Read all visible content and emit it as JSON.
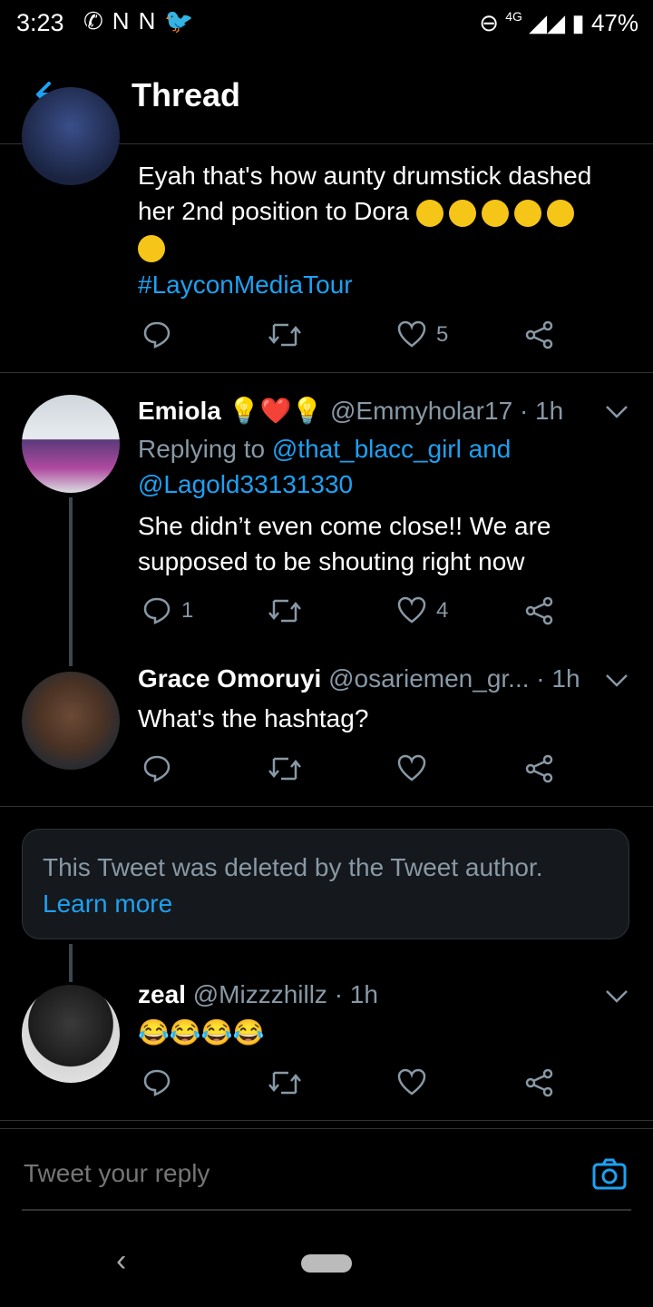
{
  "status_bar": {
    "time": "3:23",
    "notification_icons": [
      "whatsapp-icon",
      "n-icon",
      "n-icon",
      "twitter-icon"
    ],
    "network": "4G",
    "battery": "47%"
  },
  "header": {
    "title": "Thread"
  },
  "tweets": [
    {
      "text": "Eyah that's how aunty drumstick dashed her 2nd position to Dora",
      "emoji_count": 6,
      "hashtag": "#LayconMediaTour",
      "reply_count": "",
      "retweet_count": "",
      "like_count": "5"
    },
    {
      "name": "Emiola",
      "badges": [
        "💡",
        "❤️",
        "💡"
      ],
      "handle": "@Emmyholar17",
      "time": "· 1h",
      "replying_prefix": "Replying to",
      "replying_to_1": "@that_blacc_girl and",
      "replying_to_2": "@Lagold33131330",
      "text": "She didn’t even come close!! We are supposed to be shouting right now",
      "reply_count": "1",
      "retweet_count": "",
      "like_count": "4"
    },
    {
      "name": "Grace Omoruyi",
      "handle": "@osariemen_gr...",
      "time": "· 1h",
      "text": "What's the hashtag?",
      "reply_count": "",
      "retweet_count": "",
      "like_count": ""
    },
    {
      "name": "zeal",
      "handle": "@Mizzzhillz",
      "time": "· 1h",
      "text": "😂😂😂😂",
      "reply_count": "",
      "retweet_count": "",
      "like_count": ""
    }
  ],
  "deleted_notice": {
    "message": "This Tweet was deleted by the Tweet author.",
    "link": "Learn more"
  },
  "reply": {
    "placeholder": "Tweet your reply"
  },
  "colors": {
    "accent": "#1da1f2",
    "background": "#000000",
    "secondary_text": "#8899a6",
    "divider": "#2f3336"
  }
}
